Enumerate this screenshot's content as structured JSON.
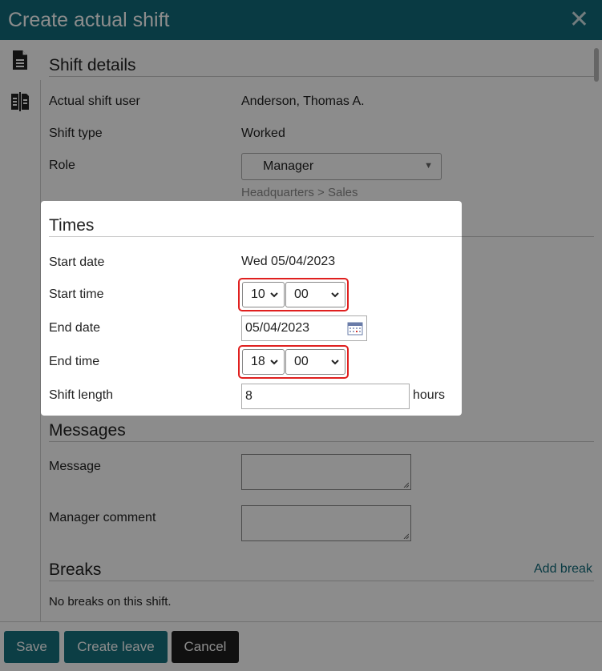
{
  "dialog": {
    "title": "Create actual shift"
  },
  "shift_details": {
    "heading": "Shift details",
    "user_label": "Actual shift user",
    "user_value": "Anderson, Thomas A.",
    "type_label": "Shift type",
    "type_value": "Worked",
    "role_label": "Role",
    "role_value": "Manager",
    "role_path": "Headquarters > Sales"
  },
  "times": {
    "heading": "Times",
    "start_date_label": "Start date",
    "start_date_value": "Wed 05/04/2023",
    "start_time_label": "Start time",
    "start_hour": "10",
    "start_minute": "00",
    "end_date_label": "End date",
    "end_date_value": "05/04/2023",
    "end_time_label": "End time",
    "end_hour": "18",
    "end_minute": "00",
    "length_label": "Shift length",
    "length_value": "8",
    "length_unit": "hours"
  },
  "messages": {
    "heading": "Messages",
    "message_label": "Message",
    "comment_label": "Manager comment"
  },
  "breaks": {
    "heading": "Breaks",
    "add_label": "Add break",
    "empty_text": "No breaks on this shift."
  },
  "footer": {
    "save_label": "Save",
    "create_leave_label": "Create leave",
    "cancel_label": "Cancel"
  },
  "colors": {
    "accent": "#116b7a",
    "highlight": "#e0201f"
  }
}
